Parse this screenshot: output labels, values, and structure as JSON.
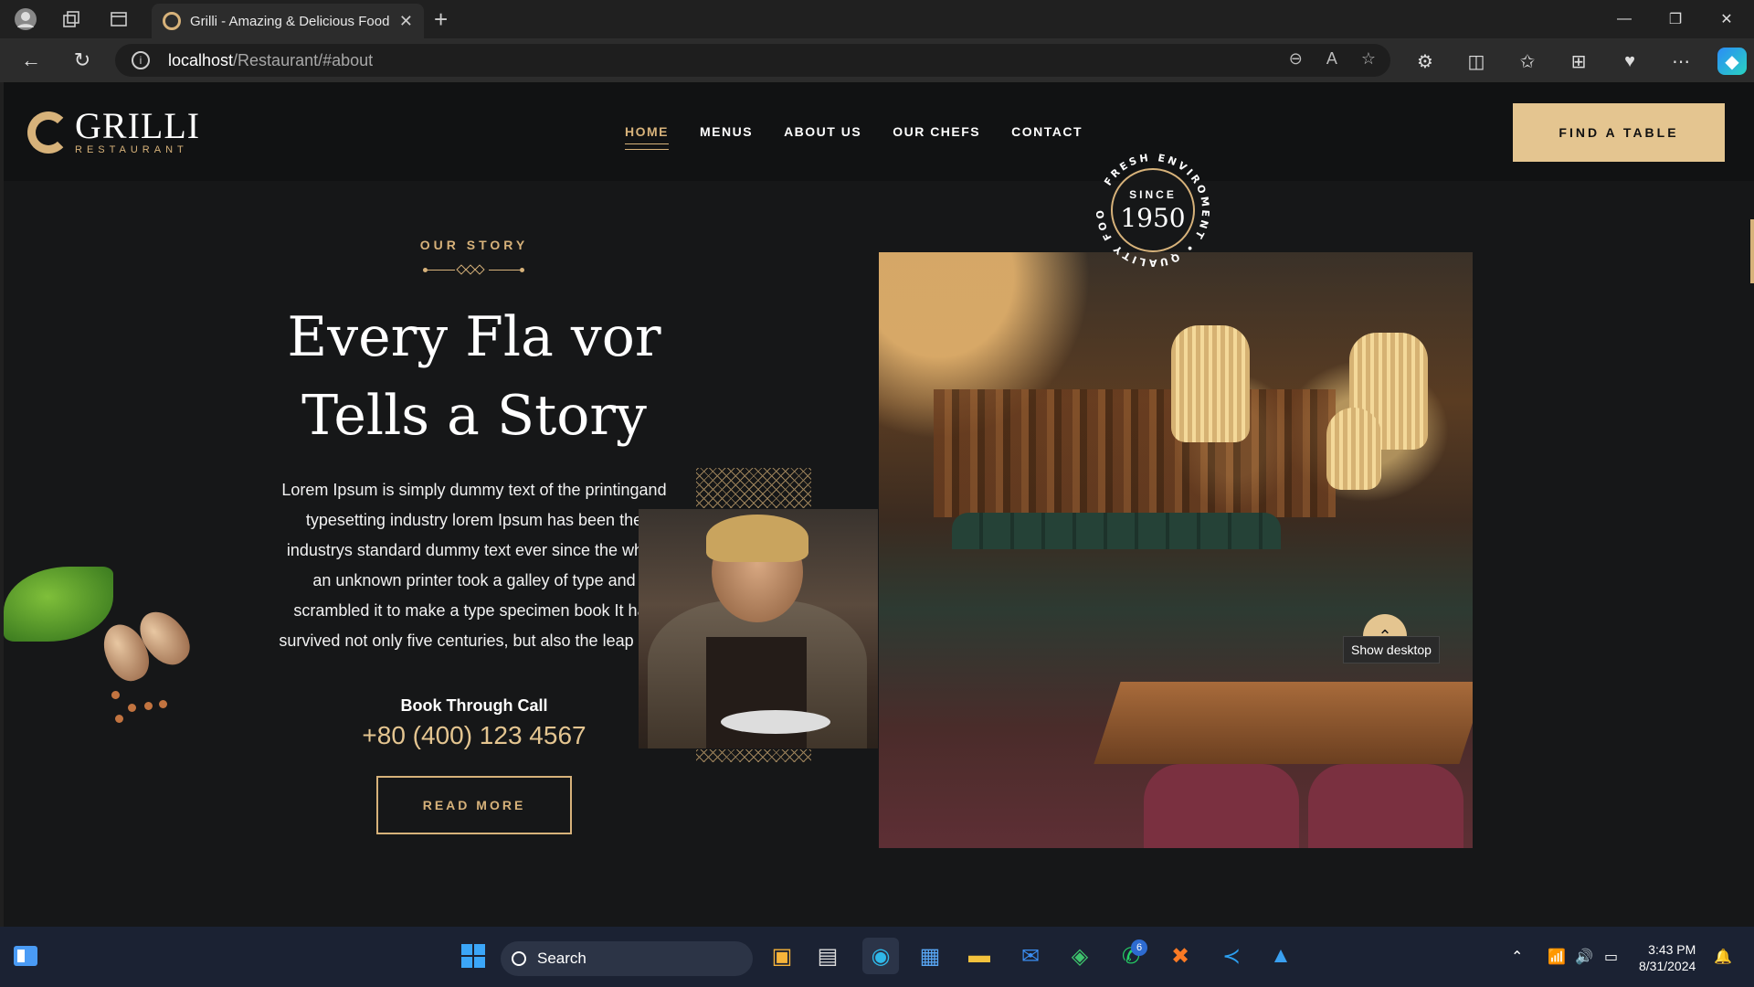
{
  "browser": {
    "tab_title": "Grilli - Amazing & Delicious Food",
    "url_host": "localhost",
    "url_path": "/Restaurant/#about"
  },
  "site": {
    "logo_name": "GRILLI",
    "logo_sub": "RESTAURANT",
    "nav": [
      {
        "label": "HOME",
        "active": true
      },
      {
        "label": "MENUS"
      },
      {
        "label": "ABOUT US"
      },
      {
        "label": "OUR CHEFS"
      },
      {
        "label": "CONTACT"
      }
    ],
    "cta": "FIND A TABLE"
  },
  "story": {
    "subtitle": "OUR STORY",
    "title_line1": "Every Fla vor",
    "title_line2": "Tells a Story",
    "text": "Lorem Ipsum is simply dummy text of the printingand typesetting industry lorem Ipsum has been the industrys standard dummy text ever since the when an unknown printer took a galley of type and scrambled it to make a type specimen book It has survived not only five centuries, but also the leap into.",
    "book_label": "Book Through Call",
    "phone": "+80 (400) 123 4567",
    "read_more": "READ MORE"
  },
  "badge": {
    "since": "SINCE",
    "year": "1950",
    "ring_text": "FRESH ENVIROMENT • QUALITY FOOD •"
  },
  "tooltip": "Show desktop",
  "taskbar": {
    "search_label": "Search",
    "whatsapp_count": "6",
    "time": "3:43 PM",
    "date": "8/31/2024"
  },
  "colors": {
    "accent": "#d7b27a",
    "button": "#e4c590",
    "page_bg": "#161718",
    "header_bg": "#111213"
  }
}
